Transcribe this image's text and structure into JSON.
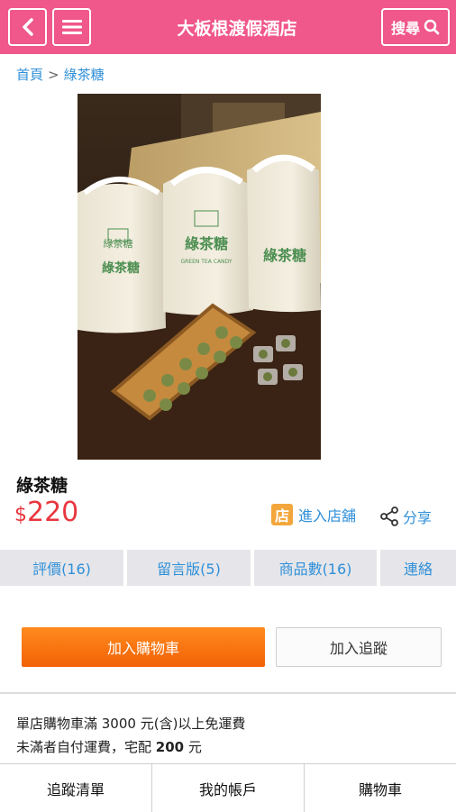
{
  "header": {
    "title": "大板根渡假酒店",
    "search_label": "搜尋",
    "color": "#f0578a"
  },
  "breadcrumb": {
    "home": "首頁",
    "separator": ">",
    "current": "綠茶糖"
  },
  "product": {
    "name": "綠茶糖",
    "currency": "$",
    "price": "220",
    "image_label": "綠茶糖",
    "image_sublabel": "GREEN TEA CANDY",
    "store_icon": "店",
    "store_link": "進入店舖",
    "share": "分享"
  },
  "tabs": [
    {
      "label": "評價(16)"
    },
    {
      "label": "留言版(5)"
    },
    {
      "label": "商品數(16)"
    },
    {
      "label": "連絡"
    }
  ],
  "actions": {
    "add_to_cart": "加入購物車",
    "add_to_tracking": "加入追蹤"
  },
  "shipping": {
    "line1": "單店購物車滿 3000 元(含)以上免運費",
    "line2_prefix": "未滿者自付運費，宅配 ",
    "line2_amount": "200",
    "line2_suffix": " 元"
  },
  "bottom_nav": [
    {
      "label": "追蹤清單"
    },
    {
      "label": "我的帳戶"
    },
    {
      "label": "購物車"
    }
  ]
}
